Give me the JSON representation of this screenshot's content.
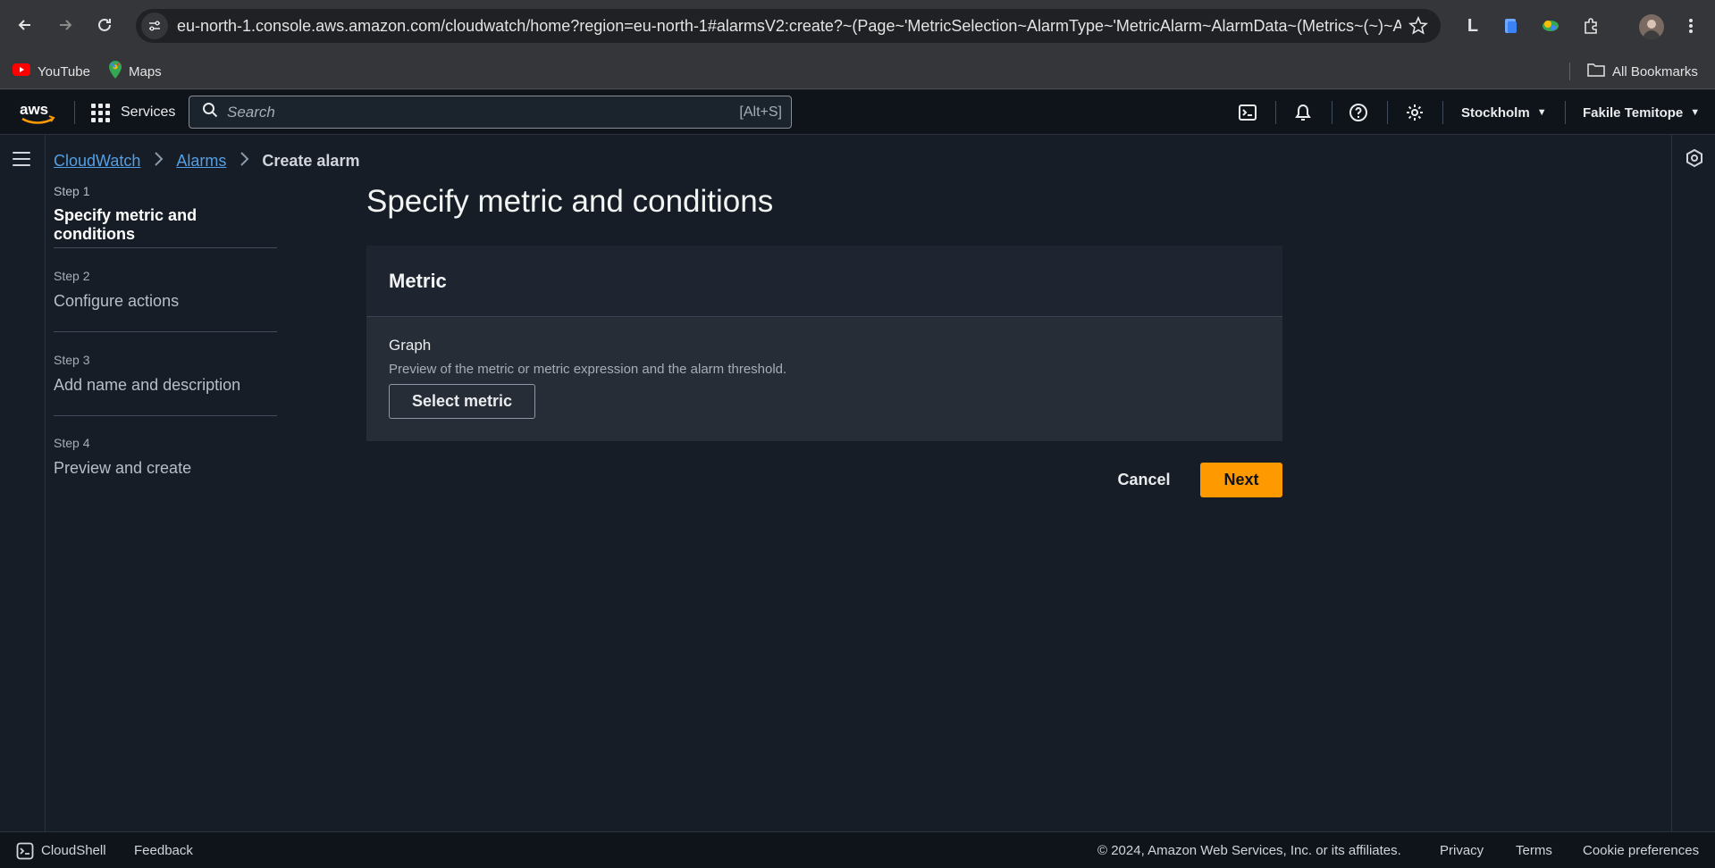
{
  "browser": {
    "url": "eu-north-1.console.aws.amazon.com/cloudwatch/home?region=eu-north-1#alarmsV2:create?~(Page~'MetricSelection~AlarmType~'MetricAlarm~AlarmData~(Metrics~(~)~Al...",
    "extension_letter": "L",
    "bookmarks": [
      {
        "label": "YouTube",
        "icon": "youtube-icon"
      },
      {
        "label": "Maps",
        "icon": "maps-icon"
      }
    ],
    "all_bookmarks": "All Bookmarks"
  },
  "header": {
    "services_label": "Services",
    "search_placeholder": "Search",
    "search_shortcut": "[Alt+S]",
    "region": "Stockholm",
    "user": "Fakile Temitope"
  },
  "breadcrumb": {
    "items": [
      "CloudWatch",
      "Alarms"
    ],
    "current": "Create alarm"
  },
  "steps": [
    {
      "number": "Step 1",
      "label": "Specify metric and conditions",
      "active": true
    },
    {
      "number": "Step 2",
      "label": "Configure actions",
      "active": false
    },
    {
      "number": "Step 3",
      "label": "Add name and description",
      "active": false
    },
    {
      "number": "Step 4",
      "label": "Preview and create",
      "active": false
    }
  ],
  "main": {
    "title": "Specify metric and conditions",
    "panel_title": "Metric",
    "graph_label": "Graph",
    "graph_description": "Preview of the metric or metric expression and the alarm threshold.",
    "select_metric_label": "Select metric",
    "cancel_label": "Cancel",
    "next_label": "Next"
  },
  "footer": {
    "cloudshell": "CloudShell",
    "feedback": "Feedback",
    "copyright": "© 2024, Amazon Web Services, Inc. or its affiliates.",
    "privacy": "Privacy",
    "terms": "Terms",
    "cookies": "Cookie preferences"
  },
  "colors": {
    "accent": "#ff9900",
    "link": "#539fe5",
    "background": "#161d26"
  }
}
